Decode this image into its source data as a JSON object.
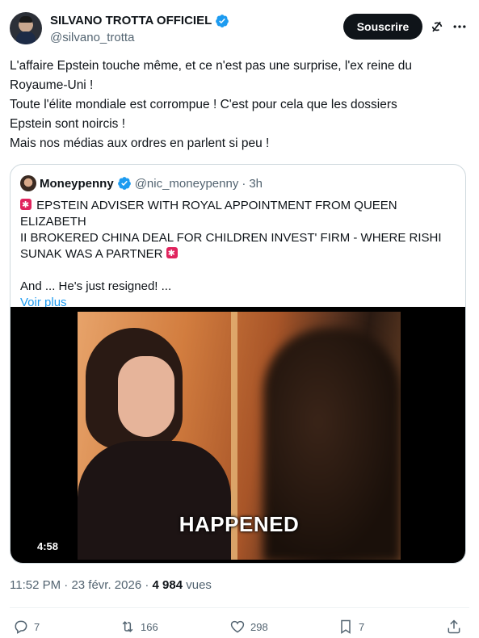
{
  "author": {
    "name": "SILVANO TROTTA OFFICIEL",
    "handle": "@silvano_trotta"
  },
  "subscribe_label": "Souscrire",
  "tweet": {
    "lines": [
      "L'affaire Epstein touche même, et ce n'est pas une surprise, l'ex reine du",
      "Royaume-Uni !",
      "Toute l'élite mondiale est corrompue ! C'est pour cela que les dossiers",
      "Epstein sont noircis !",
      "Mais nos médias aux ordres en parlent si peu !"
    ]
  },
  "quote": {
    "name": "Moneypenny",
    "handle": "@nic_moneypenny",
    "separator": "·",
    "time": "3h",
    "line1": "EPSTEIN ADVISER WITH ROYAL APPOINTMENT FROM QUEEN ELIZABETH",
    "line2": "II BROKERED CHINA DEAL FOR CHILDREN INVEST' FIRM - WHERE RISHI",
    "line3": "SUNAK WAS A PARTNER",
    "line4": "And ... He's just resigned! ...",
    "more_label": "Voir plus",
    "video": {
      "caption": "HAPPENED",
      "duration": "4:58"
    }
  },
  "meta": {
    "time": "11:52 PM",
    "date": "23 févr. 2026",
    "separator": "·",
    "views_count": "4 984",
    "views_label": "vues"
  },
  "actions": {
    "replies": "7",
    "reposts": "166",
    "likes": "298",
    "bookmarks": "7"
  },
  "colors": {
    "accent": "#1d9bf0",
    "text": "#0f1419",
    "muted": "#536471",
    "siren": "#e0245e"
  }
}
